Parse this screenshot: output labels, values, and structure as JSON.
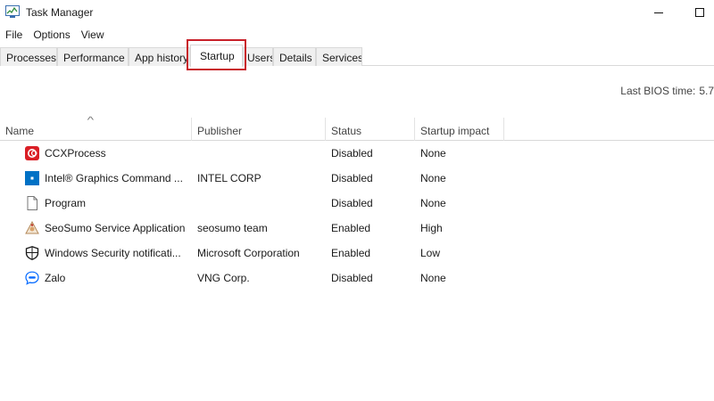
{
  "window": {
    "title": "Task Manager",
    "icon": "task-manager-icon"
  },
  "menu": [
    "File",
    "Options",
    "View"
  ],
  "tabs": [
    {
      "label": "Processes"
    },
    {
      "label": "Performance"
    },
    {
      "label": "App history"
    },
    {
      "label": "Startup",
      "active": true
    },
    {
      "label": "Users"
    },
    {
      "label": "Details"
    },
    {
      "label": "Services"
    }
  ],
  "bios": {
    "label": "Last BIOS time:",
    "value": "5.7"
  },
  "columns": [
    "Name",
    "Publisher",
    "Status",
    "Startup impact"
  ],
  "rows": [
    {
      "name": "CCXProcess",
      "publisher": "",
      "status": "Disabled",
      "impact": "None",
      "icon": "adobe-cc-icon"
    },
    {
      "name": "Intel® Graphics Command ...",
      "publisher": "INTEL CORP",
      "status": "Disabled",
      "impact": "None",
      "icon": "intel-graphics-icon"
    },
    {
      "name": "Program",
      "publisher": "",
      "status": "Disabled",
      "impact": "None",
      "icon": "blank-file-icon"
    },
    {
      "name": "SeoSumo Service Application",
      "publisher": "seosumo team",
      "status": "Enabled",
      "impact": "High",
      "icon": "seosumo-icon"
    },
    {
      "name": "Windows Security notificati...",
      "publisher": "Microsoft Corporation",
      "status": "Enabled",
      "impact": "Low",
      "icon": "windows-security-shield-icon"
    },
    {
      "name": "Zalo",
      "publisher": "VNG Corp.",
      "status": "Disabled",
      "impact": "None",
      "icon": "zalo-icon"
    }
  ],
  "colors": {
    "highlight": "#c8202a",
    "adobe": "#da1f26",
    "intel": "#0071c5",
    "zalo": "#0068ff"
  }
}
